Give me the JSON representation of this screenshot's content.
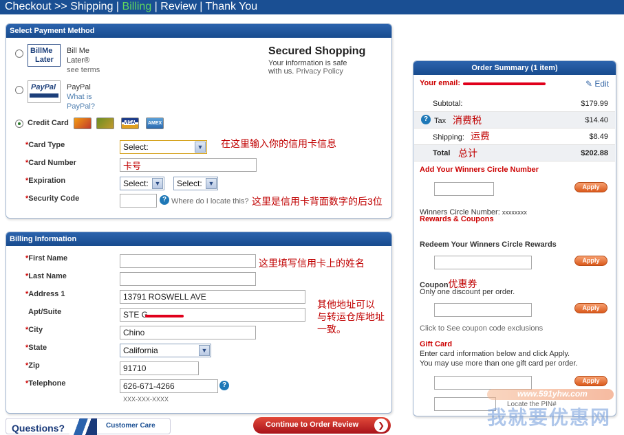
{
  "breadcrumb": {
    "steps": [
      "Checkout >>",
      "Shipping",
      "Billing",
      "Review",
      "Thank You"
    ],
    "separator": "|"
  },
  "payment": {
    "title": "Select Payment Method",
    "billme": {
      "logo_top": "BillMe",
      "logo_bottom": "Later",
      "name_line1": "Bill Me",
      "name_line2": "Later®",
      "terms": "see terms"
    },
    "paypal": {
      "logo": "PayPal",
      "name": "PayPal",
      "what1": "What is",
      "what2": "PayPal?"
    },
    "credit_card": {
      "label": "Credit Card",
      "amex": "AMEX",
      "visa": "VISA"
    },
    "secured": {
      "title": "Secured Shopping",
      "line1": "Your information is safe",
      "line2": "with us.",
      "privacy": "Privacy Policy"
    },
    "fields": {
      "card_type": {
        "label": "Card Type",
        "value": "Select:"
      },
      "card_number": {
        "label": "Card Number",
        "value": "卡号"
      },
      "expiration": {
        "label": "Expiration",
        "month": "Select:",
        "year": "Select:"
      },
      "security": {
        "label": "Security Code",
        "help_text": "Where do I locate this?"
      }
    },
    "notes": {
      "card_info": "在这里输入你的信用卡信息",
      "security": "这里是信用卡背面数字的后3位"
    }
  },
  "billing": {
    "title": "Billing Information",
    "first_name": {
      "label": "First Name",
      "value": ""
    },
    "last_name": {
      "label": "Last Name",
      "value": ""
    },
    "address1": {
      "label": "Address 1",
      "value": "13791 ROSWELL AVE"
    },
    "apt": {
      "label": "Apt/Suite",
      "value": "STE G"
    },
    "city": {
      "label": "City",
      "value": "Chino"
    },
    "state": {
      "label": "State",
      "value": "California"
    },
    "zip": {
      "label": "Zip",
      "value": "91710"
    },
    "telephone": {
      "label": "Telephone",
      "value": "626-671-4266",
      "format": "XXX-XXX-XXXX"
    },
    "notes": {
      "name": "这里填写信用卡上的姓名",
      "address_l1": "其他地址可以",
      "address_l2": "与转运仓库地址",
      "address_l3": "一致。"
    }
  },
  "footer": {
    "questions": "Questions?",
    "customer_care": "Customer Care",
    "continue": "Continue to Order Review"
  },
  "summary": {
    "title": "Order Summary (1 item)",
    "email_label": "Your email:",
    "edit": "Edit",
    "rows": [
      {
        "label": "Subtotal:",
        "note": "",
        "value": "$179.99"
      },
      {
        "label": "Tax",
        "note": "消费税",
        "value": "$14.40"
      },
      {
        "label": "Shipping:",
        "note": "运费",
        "value": "$8.49"
      },
      {
        "label": "Total",
        "note": "总计",
        "value": "$202.88"
      }
    ],
    "winners": {
      "title": "Add Your Winners Circle Number",
      "apply": "Apply",
      "number_label": "Winners Circle Number:",
      "number_value": "xxxxxxxx",
      "rewards": "Rewards & Coupons"
    },
    "redeem": {
      "title": "Redeem Your Winners Circle Rewards",
      "apply": "Apply"
    },
    "coupon": {
      "title": "Coupon",
      "note": "优惠券",
      "sub": "Only one discount per order.",
      "apply": "Apply",
      "exclusions": "Click to See coupon code exclusions"
    },
    "gift": {
      "title": "Gift Card",
      "line1": "Enter card information below and click Apply.",
      "line2": "You may use more than one gift card per order.",
      "apply": "Apply",
      "pin": "Locate the PIN#"
    }
  },
  "watermark": {
    "url": "www.591yhw.com",
    "name": "我就要优惠网"
  },
  "colors": {
    "header_blue": "#1a4f93",
    "accent_red": "#cc0000",
    "active_green": "#5fd65f",
    "apply_orange": "#db5a1c"
  }
}
